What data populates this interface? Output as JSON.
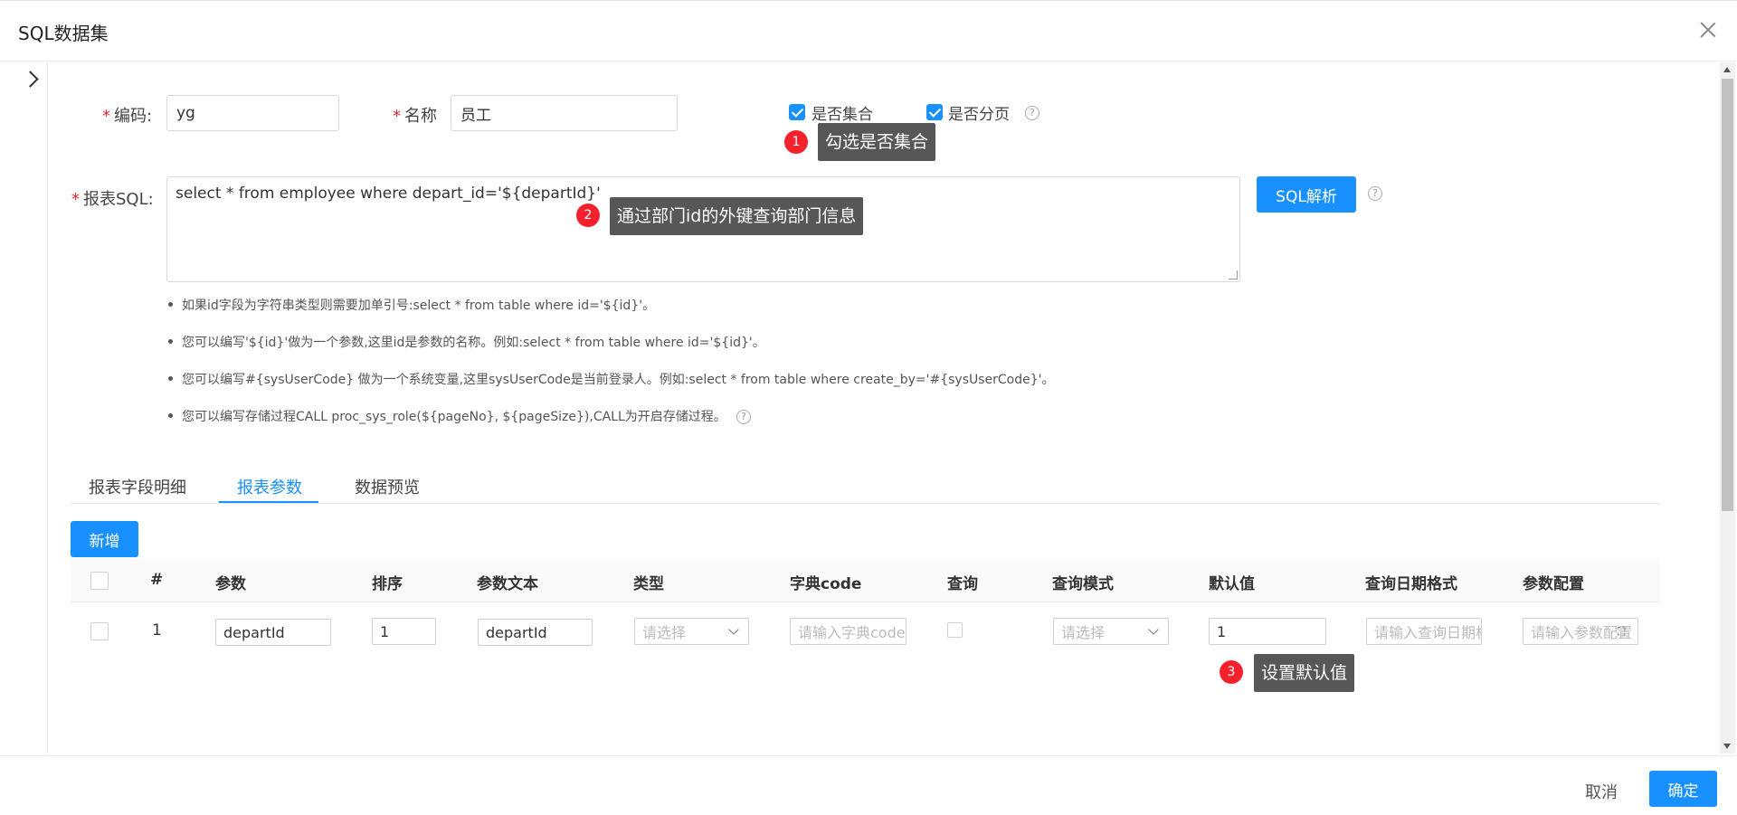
{
  "dialog": {
    "title": "SQL数据集"
  },
  "form": {
    "code_label": "编码:",
    "code_value": "yg",
    "name_label": "名称",
    "name_value": "员工",
    "is_collection_label": "是否集合",
    "is_paged_label": "是否分页",
    "sql_label": "报表SQL:",
    "sql_value": "select * from employee where depart_id='${departId}'",
    "parse_button": "SQL解析",
    "help_glyph": "?"
  },
  "hints": [
    "如果id字段为字符串类型则需要加单引号:select * from table where id='${id}'。",
    "您可以编写'${id}'做为一个参数,这里id是参数的名称。例如:select * from table where id='${id}'。",
    "您可以编写#{sysUserCode} 做为一个系统变量,这里sysUserCode是当前登录人。例如:select * from table where create_by='#{sysUserCode}'。",
    "您可以编写存储过程CALL proc_sys_role(${pageNo}, ${pageSize}),CALL为开启存储过程。"
  ],
  "tabs": [
    "报表字段明细",
    "报表参数",
    "数据预览"
  ],
  "add_button": "新增",
  "table": {
    "headers": [
      "#",
      "参数",
      "排序",
      "参数文本",
      "类型",
      "字典code",
      "查询",
      "查询模式",
      "默认值",
      "查询日期格式",
      "参数配置"
    ],
    "row": {
      "index": "1",
      "param": "departId",
      "order": "1",
      "param_text": "departId",
      "type_placeholder": "请选择",
      "dict_placeholder": "请输入字典code",
      "query_mode_placeholder": "请选择",
      "default_value": "1",
      "date_format_placeholder": "请输入查询日期格式",
      "config_placeholder": "请输入参数配置"
    }
  },
  "annotations": [
    {
      "num": "1",
      "text": "勾选是否集合"
    },
    {
      "num": "2",
      "text": "通过部门id的外键查询部门信息"
    },
    {
      "num": "3",
      "text": "设置默认值"
    }
  ],
  "footer": {
    "cancel": "取消",
    "ok": "确定"
  },
  "colors": {
    "primary": "#1890ff",
    "badge": "#f5222d",
    "tooltip": "#575757"
  }
}
